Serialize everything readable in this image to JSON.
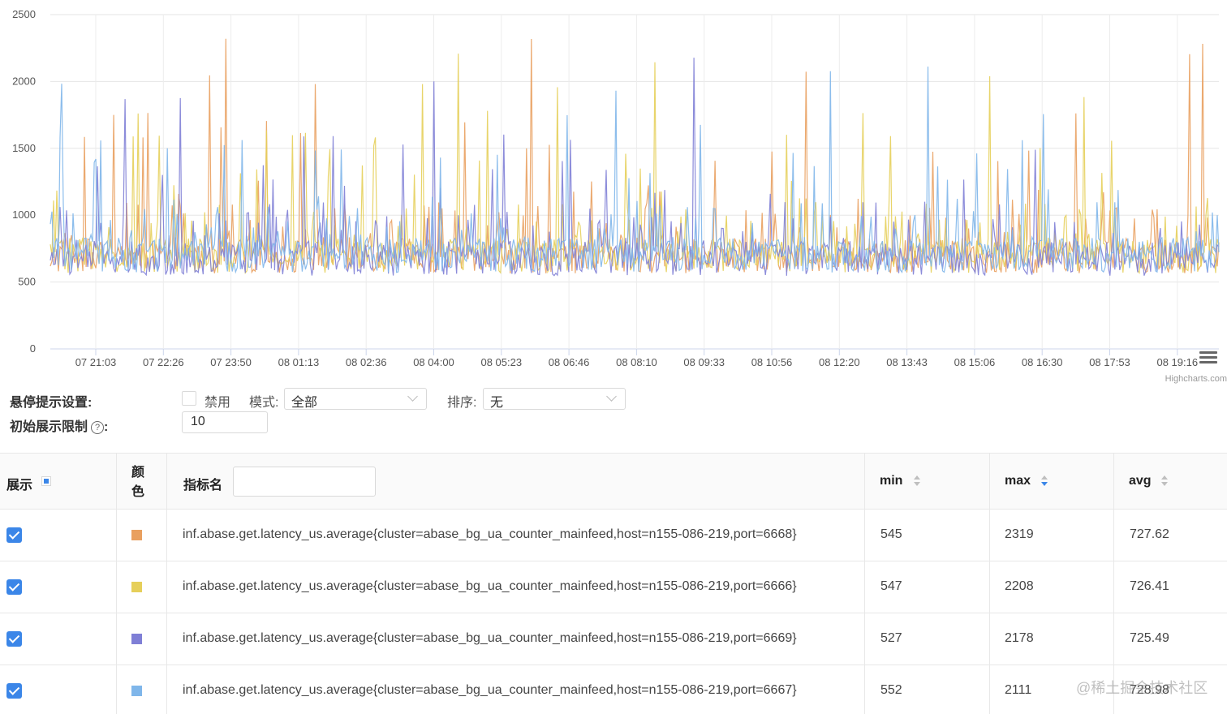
{
  "chart_data": {
    "type": "line",
    "y_ticks": [
      "2500",
      "2000",
      "1500",
      "1000",
      "500",
      "0"
    ],
    "ylim": [
      0,
      2500
    ],
    "x_ticks": [
      "07 21:03",
      "07 22:26",
      "07 23:50",
      "08 01:13",
      "08 02:36",
      "08 04:00",
      "08 05:23",
      "08 06:46",
      "08 08:10",
      "08 09:33",
      "08 10:56",
      "08 12:20",
      "08 13:43",
      "08 15:06",
      "08 16:30",
      "08 17:53",
      "08 19:16"
    ],
    "grid": true,
    "series": [
      {
        "name": "inf.abase.get.latency_us.average{cluster=abase_bg_ua_counter_mainfeed,host=n155-086-219,port=6668}",
        "color": "#e9a05f",
        "min": 545,
        "max": 2319,
        "avg": 727.62
      },
      {
        "name": "inf.abase.get.latency_us.average{cluster=abase_bg_ua_counter_mainfeed,host=n155-086-219,port=6666}",
        "color": "#e6cf5a",
        "min": 547,
        "max": 2208,
        "avg": 726.41
      },
      {
        "name": "inf.abase.get.latency_us.average{cluster=abase_bg_ua_counter_mainfeed,host=n155-086-219,port=6669}",
        "color": "#7f7fd6",
        "min": 527,
        "max": 2178,
        "avg": 725.49
      },
      {
        "name": "inf.abase.get.latency_us.average{cluster=abase_bg_ua_counter_mainfeed,host=n155-086-219,port=6667}",
        "color": "#7fb6ea",
        "min": 552,
        "max": 2111,
        "avg": 728.98
      }
    ],
    "credits": "Highcharts.com"
  },
  "settings": {
    "hover_label": "悬停提示设置:",
    "disable_label": "禁用",
    "mode_label": "模式:",
    "mode_value": "全部",
    "sort_label": "排序:",
    "sort_value": "无",
    "limit_label": "初始展示限制",
    "limit_help": "?",
    "limit_colon": ":",
    "limit_value": "10"
  },
  "table": {
    "col_show": "展示",
    "col_color": "颜\n色",
    "col_metric": "指标名",
    "col_min": "min",
    "col_max": "max",
    "col_avg": "avg",
    "rows": [
      {
        "name": "inf.abase.get.latency_us.average{cluster=abase_bg_ua_counter_mainfeed,host=n155-086-219,port=6668}",
        "min": "545",
        "max": "2319",
        "avg": "727.62"
      },
      {
        "name": "inf.abase.get.latency_us.average{cluster=abase_bg_ua_counter_mainfeed,host=n155-086-219,port=6666}",
        "min": "547",
        "max": "2208",
        "avg": "726.41"
      },
      {
        "name": "inf.abase.get.latency_us.average{cluster=abase_bg_ua_counter_mainfeed,host=n155-086-219,port=6669}",
        "min": "527",
        "max": "2178",
        "avg": "725.49"
      },
      {
        "name": "inf.abase.get.latency_us.average{cluster=abase_bg_ua_counter_mainfeed,host=n155-086-219,port=6667}",
        "min": "552",
        "max": "2111",
        "avg": "728.98"
      }
    ]
  },
  "watermark": {
    "main": "@稀土掘金技术社区"
  }
}
